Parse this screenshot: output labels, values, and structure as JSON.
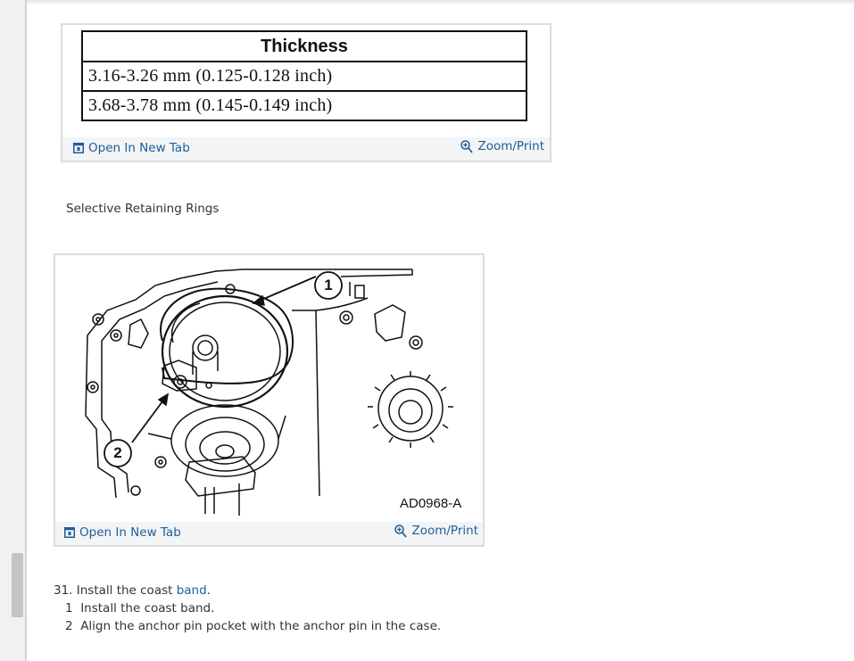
{
  "colors": {
    "link": "#1f5d99",
    "body_text": "#333333",
    "footer_bg": "#f3f4f6",
    "border": "#dcdcdc"
  },
  "thickness_figure": {
    "table": {
      "header": "Thickness",
      "rows": [
        "3.16-3.26 mm (0.125-0.128 inch)",
        "3.68-3.78 mm (0.145-0.149 inch)"
      ]
    },
    "footer": {
      "open_label": "Open In New Tab",
      "open_icon": "open-in-new-tab-icon",
      "zoom_label": "Zoom/Print",
      "zoom_icon": "zoom-in-icon"
    }
  },
  "caption": "Selective Retaining Rings",
  "band_figure": {
    "callouts": [
      "1",
      "2"
    ],
    "figure_code": "AD0968-A",
    "footer": {
      "open_label": "Open In New Tab",
      "open_icon": "open-in-new-tab-icon",
      "zoom_label": "Zoom/Print",
      "zoom_icon": "zoom-in-icon"
    }
  },
  "instructions": {
    "step_prefix": "31. Install the coast ",
    "step_link": "band",
    "step_suffix": ".",
    "substeps": [
      {
        "num": "1",
        "text": "Install the coast band."
      },
      {
        "num": "2",
        "text": "Align the anchor pin pocket with the anchor pin in the case."
      }
    ]
  }
}
